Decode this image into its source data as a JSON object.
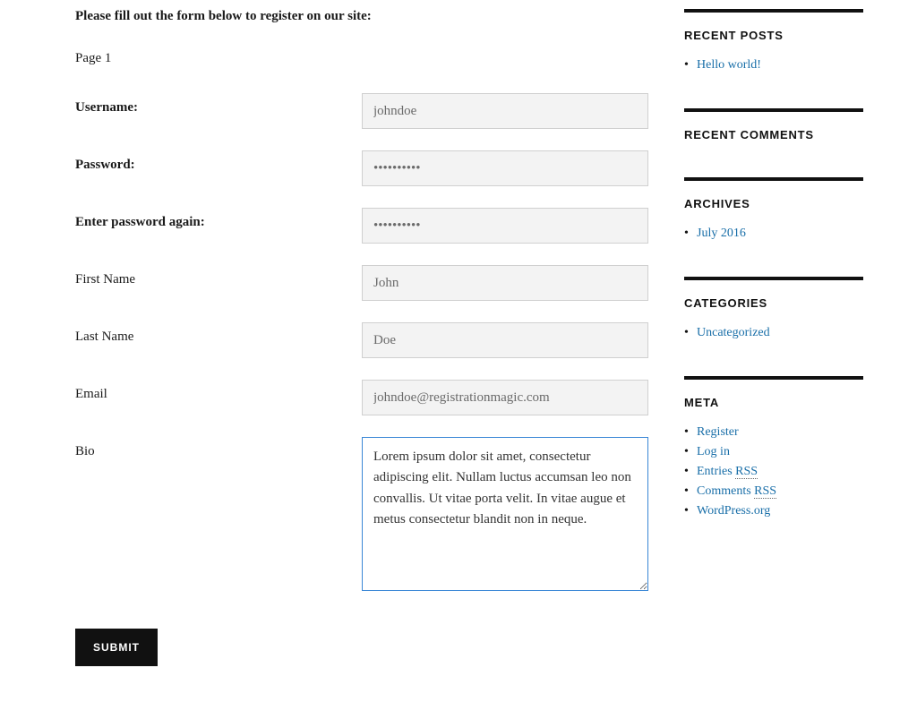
{
  "intro": "Please fill out the form below to register on our site:",
  "page_label": "Page 1",
  "form": {
    "username": {
      "label": "Username:",
      "value": "johndoe"
    },
    "password": {
      "label": "Password:",
      "value": "••••••••••"
    },
    "password2": {
      "label": "Enter password again:",
      "value": "••••••••••"
    },
    "firstname": {
      "label": "First Name",
      "value": "John"
    },
    "lastname": {
      "label": "Last Name",
      "value": "Doe"
    },
    "email": {
      "label": "Email",
      "value": "johndoe@registrationmagic.com"
    },
    "bio": {
      "label": "Bio",
      "value": "Lorem ipsum dolor sit amet, consectetur adipiscing elit. Nullam luctus accumsan leo non convallis. Ut vitae porta velit. In vitae augue et metus consectetur blandit non in neque."
    },
    "submit": "Submit"
  },
  "sidebar": {
    "recent_posts": {
      "title": "Recent Posts",
      "items": [
        "Hello world!"
      ]
    },
    "recent_comments": {
      "title": "Recent Comments"
    },
    "archives": {
      "title": "Archives",
      "items": [
        "July 2016"
      ]
    },
    "categories": {
      "title": "Categories",
      "items": [
        "Uncategorized"
      ]
    },
    "meta": {
      "title": "Meta",
      "register": "Register",
      "login": "Log in",
      "entries_prefix": "Entries ",
      "entries_rss": "RSS",
      "comments_prefix": "Comments ",
      "comments_rss": "RSS",
      "wporg": "WordPress.org"
    }
  }
}
